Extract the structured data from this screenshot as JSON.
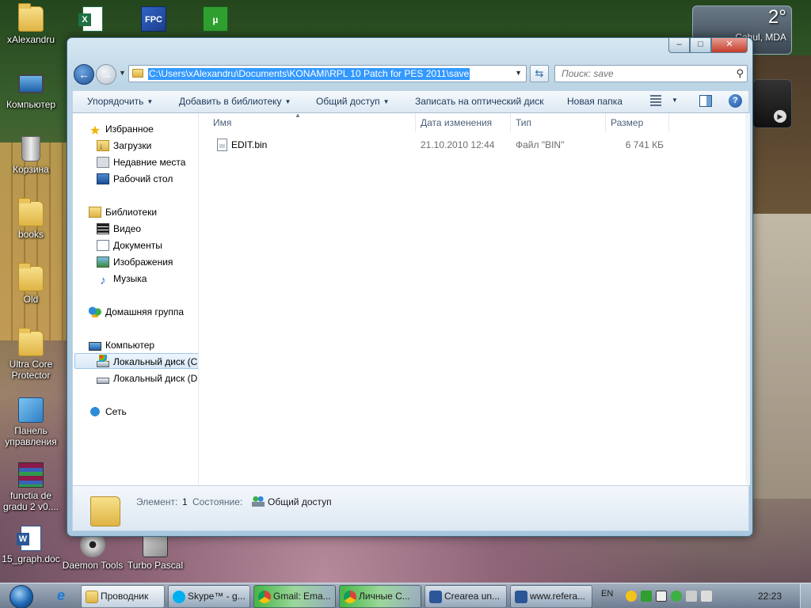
{
  "desktop": {
    "icons": [
      {
        "label": "xAlexandru",
        "icon": "user-folder-icon"
      },
      {
        "label": "Компьютер",
        "icon": "computer-icon"
      },
      {
        "label": "Корзина",
        "icon": "recycle-bin-icon"
      },
      {
        "label": "books",
        "icon": "folder-icon"
      },
      {
        "label": "Old",
        "icon": "folder-icon"
      },
      {
        "label": "Ultra Core Protector",
        "icon": "folder-icon"
      },
      {
        "label": "Панель управления",
        "icon": "control-panel-icon"
      },
      {
        "label": "functia de gradu 2 v0....",
        "icon": "winrar-icon"
      },
      {
        "label": "15_graph.doc",
        "icon": "word-doc-icon"
      },
      {
        "label": "Daemon Tools",
        "icon": "daemon-tools-icon"
      },
      {
        "label": "Turbo Pascal",
        "icon": "turbo-pascal-icon"
      }
    ]
  },
  "weather_gadget": {
    "temperature": "2°",
    "location": "Cahul, MDA"
  },
  "explorer": {
    "address_path": "C:\\Users\\xAlexandru\\Documents\\KONAMI\\RPL 10 Patch for PES 2011\\save",
    "search_placeholder": "Поиск: save",
    "toolbar": {
      "organize": "Упорядочить",
      "add_to_library": "Добавить в библиотеку",
      "share": "Общий доступ",
      "burn": "Записать на оптический диск",
      "new_folder": "Новая папка"
    },
    "nav": {
      "favorites": "Избранное",
      "downloads": "Загрузки",
      "recent_places": "Недавние места",
      "desktop": "Рабочий стол",
      "libraries": "Библиотеки",
      "video": "Видео",
      "documents": "Документы",
      "images": "Изображения",
      "music": "Музыка",
      "homegroup": "Домашняя группа",
      "computer": "Компьютер",
      "local_disk_c": "Локальный диск (C",
      "local_disk_d": "Локальный диск (D",
      "network": "Сеть"
    },
    "columns": {
      "name": "Имя",
      "date_modified": "Дата изменения",
      "type": "Тип",
      "size": "Размер"
    },
    "files": [
      {
        "name": "EDIT.bin",
        "date_modified": "21.10.2010 12:44",
        "type": "Файл \"BIN\"",
        "size": "6 741 КБ"
      }
    ],
    "details": {
      "items_label": "Элемент:",
      "items_count": "1",
      "state_label": "Состояние:",
      "state_value": "Общий доступ"
    }
  },
  "taskbar": {
    "tasks": [
      {
        "label": "Проводник",
        "icon": "explorer-icon"
      },
      {
        "label": "Skype™ - g...",
        "icon": "skype-icon"
      },
      {
        "label": "Gmail: Ema...",
        "icon": "chrome-icon"
      },
      {
        "label": "Личные С...",
        "icon": "chrome-icon"
      },
      {
        "label": "Crearea un...",
        "icon": "word-icon"
      },
      {
        "label": "www.refera...",
        "icon": "word-icon"
      }
    ],
    "language": "EN",
    "clock": "22:23"
  }
}
